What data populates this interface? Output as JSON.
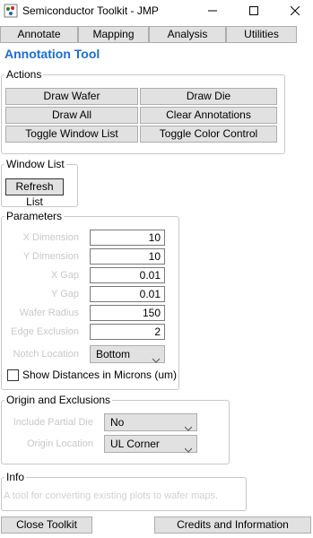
{
  "window": {
    "title": "Semiconductor Toolkit - JMP"
  },
  "tabs": [
    "Annotate",
    "Mapping",
    "Analysis",
    "Utilities"
  ],
  "tool_title": "Annotation Tool",
  "actions": {
    "legend": "Actions",
    "buttons": [
      "Draw Wafer",
      "Draw Die",
      "Draw All",
      "Clear Annotations",
      "Toggle Window List",
      "Toggle Color Control"
    ]
  },
  "window_list": {
    "legend": "Window List",
    "refresh_label": "Refresh List"
  },
  "parameters": {
    "legend": "Parameters",
    "fields": [
      {
        "label": "X Dimension",
        "value": "10"
      },
      {
        "label": "Y Dimension",
        "value": "10"
      },
      {
        "label": "X Gap",
        "value": "0.01"
      },
      {
        "label": "Y Gap",
        "value": "0.01"
      },
      {
        "label": "Wafer Radius",
        "value": "150"
      },
      {
        "label": "Edge Exclusion",
        "value": "2"
      }
    ],
    "notch_label": "Notch Location",
    "notch_value": "Bottom",
    "show_microns_label": "Show Distances in Microns (um)",
    "show_microns_checked": false
  },
  "origin": {
    "legend": "Origin and Exclusions",
    "partial_label": "Include Partial Die",
    "partial_value": "No",
    "origin_label": "Origin Location",
    "origin_value": "UL Corner"
  },
  "info": {
    "legend": "Info",
    "text": "A tool for converting existing plots to wafer maps."
  },
  "footer": {
    "close_label": "Close Toolkit",
    "credits_label": "Credits and Information"
  },
  "colors": {
    "accent": "#1a6ed8",
    "button_bg": "#e1e1e1",
    "border": "#adadad"
  }
}
